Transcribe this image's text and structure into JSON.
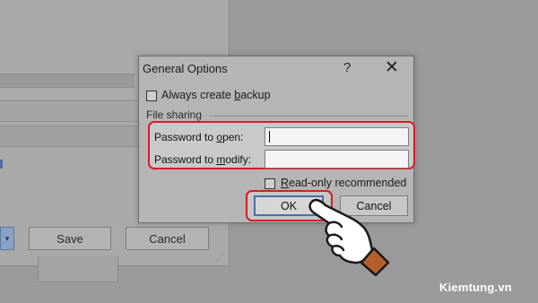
{
  "background_dialog": {
    "save_label": "Save",
    "cancel_label": "Cancel",
    "dropdown_arrow": "▾"
  },
  "dialog": {
    "title": "General Options",
    "help_glyph": "?",
    "close_glyph": "✕",
    "always_backup": {
      "pre": "Always create ",
      "underlined": "b",
      "post": "ackup",
      "checked": false
    },
    "file_sharing_label": "File sharing",
    "password_open": {
      "pre": "Password to ",
      "underlined": "o",
      "post": "pen:",
      "value": ""
    },
    "password_modify": {
      "pre": "Password to ",
      "underlined": "m",
      "post": "odify:",
      "value": ""
    },
    "read_only": {
      "pre": "",
      "underlined": "R",
      "post": "ead-only recommended",
      "checked": false
    },
    "ok_label": "OK",
    "cancel_label": "Cancel"
  },
  "highlight_color": "#d81b24",
  "pointer_icon": "pointing-hand-icon",
  "watermark": "Kiemtung.vn"
}
